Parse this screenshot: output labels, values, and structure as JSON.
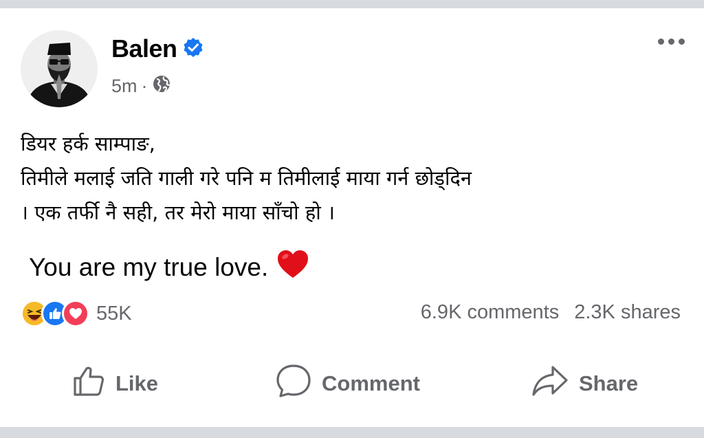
{
  "post": {
    "author": "Balen",
    "verified_icon": "verified-badge-icon",
    "time": "5m",
    "separator": "·",
    "privacy_icon": "globe-icon",
    "more_icon": "more-options-icon",
    "lines": [
      "डियर हर्क साम्पाङ,",
      "तिमीले मलाई जति गाली गरे पनि म तिमीलाई माया गर्न छोड्दिन",
      "। एक तर्फी नै सही, तर मेरो माया साँचो हो ।"
    ],
    "english_line": "You are my true love.",
    "heart_emoji": "red-heart-icon"
  },
  "reactions": {
    "icons": [
      "laughing-face-icon",
      "like-reaction-icon",
      "love-reaction-icon"
    ],
    "count": "55K",
    "comments": "6.9K comments",
    "shares": "2.3K shares"
  },
  "actions": {
    "like": "Like",
    "comment": "Comment",
    "share": "Share"
  },
  "colors": {
    "verified": "#1877f2",
    "like_blue": "#1877f2",
    "love_red": "#f33e58",
    "haha_yellow": "#f7b928",
    "muted": "#65676b",
    "divider": "#d7dadf"
  }
}
